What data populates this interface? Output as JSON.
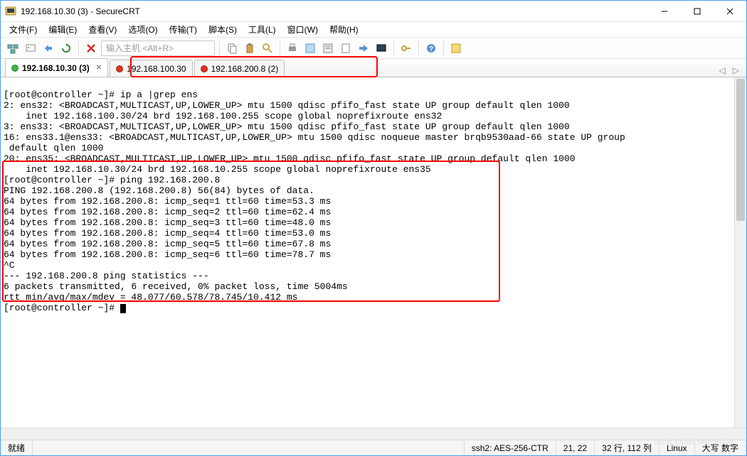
{
  "title": "192.168.10.30 (3) - SecureCRT",
  "menus": {
    "file": "文件(F)",
    "edit": "编辑(E)",
    "view": "查看(V)",
    "options": "选项(O)",
    "transfer": "传输(T)",
    "script": "脚本(S)",
    "tools": "工具(L)",
    "window": "窗口(W)",
    "help": "帮助(H)"
  },
  "host_placeholder": "输入主机 <Alt+R>",
  "tabs": [
    {
      "label": "192.168.10.30 (3)",
      "state": "green",
      "active": true
    },
    {
      "label": "192.168.100.30",
      "state": "red",
      "active": false
    },
    {
      "label": "192.168.200.8 (2)",
      "state": "red",
      "active": false
    }
  ],
  "terminal": {
    "l01": "[root@controller ~]# ip a |grep ens",
    "l02": "2: ens32: <BROADCAST,MULTICAST,UP,LOWER_UP> mtu 1500 qdisc pfifo_fast state UP group default qlen 1000",
    "l03": "    inet 192.168.100.30/24 brd 192.168.100.255 scope global noprefixroute ens32",
    "l04": "3: ens33: <BROADCAST,MULTICAST,UP,LOWER_UP> mtu 1500 qdisc pfifo_fast state UP group default qlen 1000",
    "l05": "16: ens33.1@ens33: <BROADCAST,MULTICAST,UP,LOWER_UP> mtu 1500 qdisc noqueue master brqb9530aad-66 state UP group",
    "l06": " default qlen 1000",
    "l07": "20: ens35: <BROADCAST,MULTICAST,UP,LOWER_UP> mtu 1500 qdisc pfifo_fast state UP group default qlen 1000",
    "l08": "    inet 192.168.10.30/24 brd 192.168.10.255 scope global noprefixroute ens35",
    "l09": "[root@controller ~]# ping 192.168.200.8",
    "l10": "PING 192.168.200.8 (192.168.200.8) 56(84) bytes of data.",
    "l11": "64 bytes from 192.168.200.8: icmp_seq=1 ttl=60 time=53.3 ms",
    "l12": "64 bytes from 192.168.200.8: icmp_seq=2 ttl=60 time=62.4 ms",
    "l13": "64 bytes from 192.168.200.8: icmp_seq=3 ttl=60 time=48.0 ms",
    "l14": "64 bytes from 192.168.200.8: icmp_seq=4 ttl=60 time=53.0 ms",
    "l15": "64 bytes from 192.168.200.8: icmp_seq=5 ttl=60 time=67.8 ms",
    "l16": "64 bytes from 192.168.200.8: icmp_seq=6 ttl=60 time=78.7 ms",
    "l17": "^C",
    "l18": "--- 192.168.200.8 ping statistics ---",
    "l19": "6 packets transmitted, 6 received, 0% packet loss, time 5004ms",
    "l20": "rtt min/avg/max/mdev = 48.077/60.578/78.745/10.412 ms",
    "l21": "[root@controller ~]# "
  },
  "status": {
    "ready": "就绪",
    "cipher": "ssh2: AES-256-CTR",
    "pos": "21, 22",
    "size": "32 行, 112 列",
    "proto": "Linux",
    "caps": "大写 数字"
  },
  "watermark": "blog.csdn.net/weixi",
  "colors": {
    "accent": "#4da0e8",
    "red": "#ff0000"
  },
  "icons": {
    "app": "app-icon",
    "min": "minimize-icon",
    "max": "maximize-icon",
    "close": "close-icon",
    "tb": [
      "session-icon",
      "connect-icon",
      "reconnect-icon",
      "quick-icon",
      "disconnect-icon",
      "copy-icon",
      "paste-icon",
      "find-icon",
      "print-icon",
      "options-icon",
      "transfer-icon",
      "screen-icon",
      "zoom-icon",
      "key-icon",
      "help-icon",
      "btn-icon"
    ]
  }
}
